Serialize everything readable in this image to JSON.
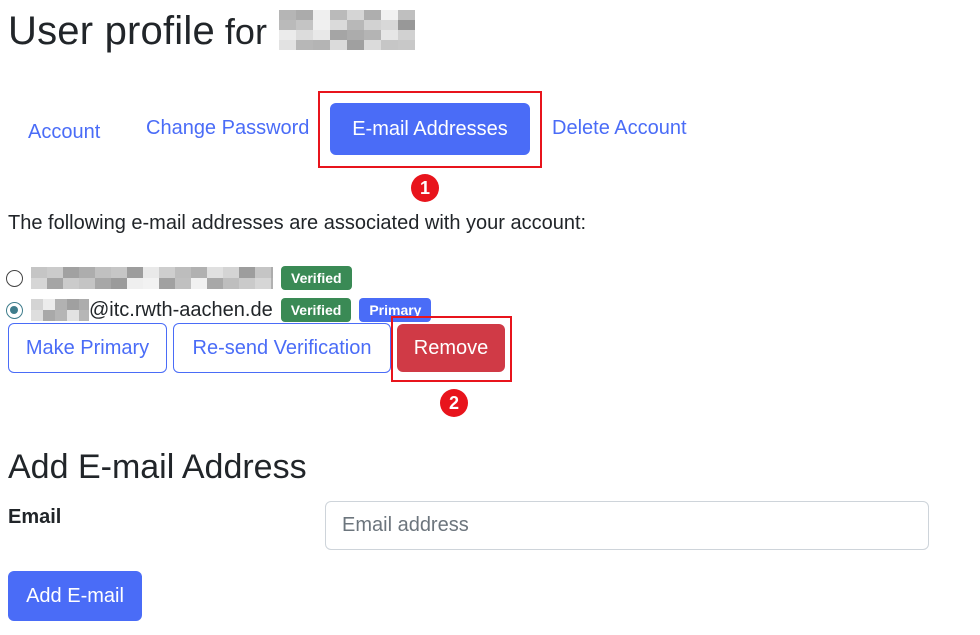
{
  "header": {
    "title": "User profile",
    "title_for": "for"
  },
  "tabs": [
    {
      "label": "Account",
      "active": false
    },
    {
      "label": "Change Password",
      "active": false
    },
    {
      "label": "E-mail Addresses",
      "active": true
    },
    {
      "label": "Delete Account",
      "active": false
    }
  ],
  "annotations": {
    "step1": "1",
    "step2": "2",
    "highlight_color": "#e8141c"
  },
  "emails": {
    "intro": "The following e-mail addresses are associated with your account:",
    "list": [
      {
        "domain": "",
        "selected": false,
        "badges": [
          "Verified"
        ]
      },
      {
        "domain": "@itc.rwth-aachen.de",
        "selected": true,
        "badges": [
          "Verified",
          "Primary"
        ]
      }
    ],
    "actions": {
      "make_primary": "Make Primary",
      "resend": "Re-send Verification",
      "remove": "Remove"
    }
  },
  "add_email": {
    "title": "Add E-mail Address",
    "label": "Email",
    "placeholder": "Email address",
    "value": "",
    "submit": "Add E-mail"
  },
  "colors": {
    "primary": "#4a6cf7",
    "danger": "#d03a46",
    "verified": "#3a8a55"
  }
}
